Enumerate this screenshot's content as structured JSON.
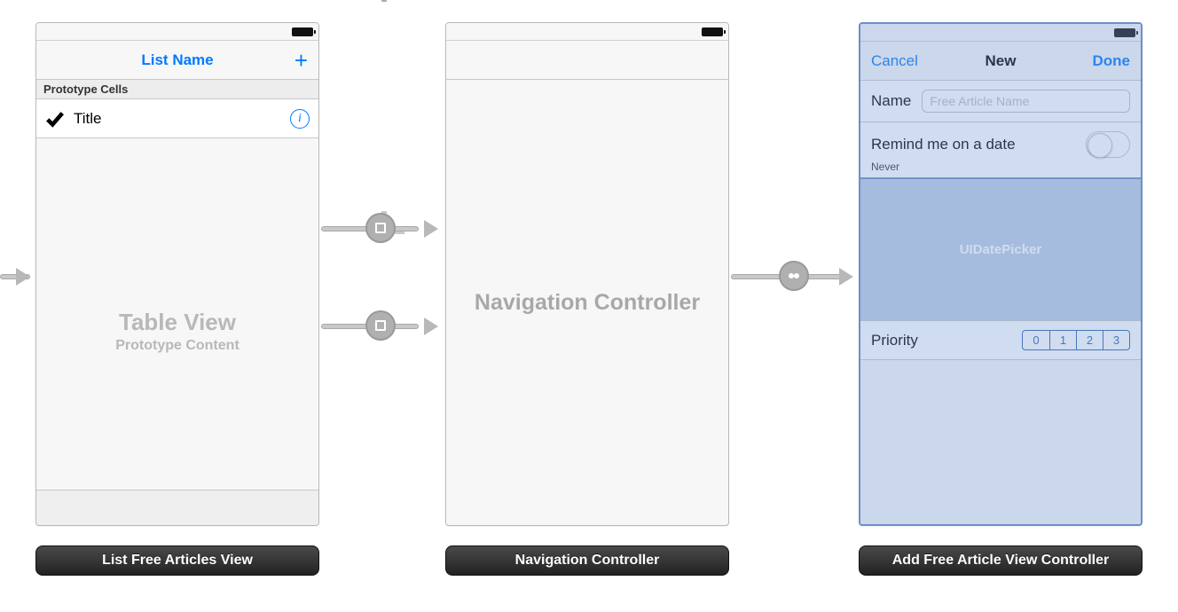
{
  "scenes": {
    "list": {
      "label": "List Free Articles View",
      "nav_title": "List Name",
      "nav_add": "+",
      "proto_header": "Prototype Cells",
      "cell_title": "Title",
      "placeholder_title": "Table View",
      "placeholder_sub": "Prototype Content"
    },
    "nav": {
      "label": "Navigation Controller",
      "placeholder": "Navigation Controller"
    },
    "add": {
      "label": "Add Free Article View Controller",
      "nav_cancel": "Cancel",
      "nav_title": "New",
      "nav_done": "Done",
      "name_label": "Name",
      "name_placeholder": "Free Article Name",
      "remind_label": "Remind me on a date",
      "remind_sub": "Never",
      "datepicker_label": "UIDatePicker",
      "priority_label": "Priority",
      "priority_options": [
        "0",
        "1",
        "2",
        "3"
      ]
    }
  },
  "info_glyph": "i"
}
